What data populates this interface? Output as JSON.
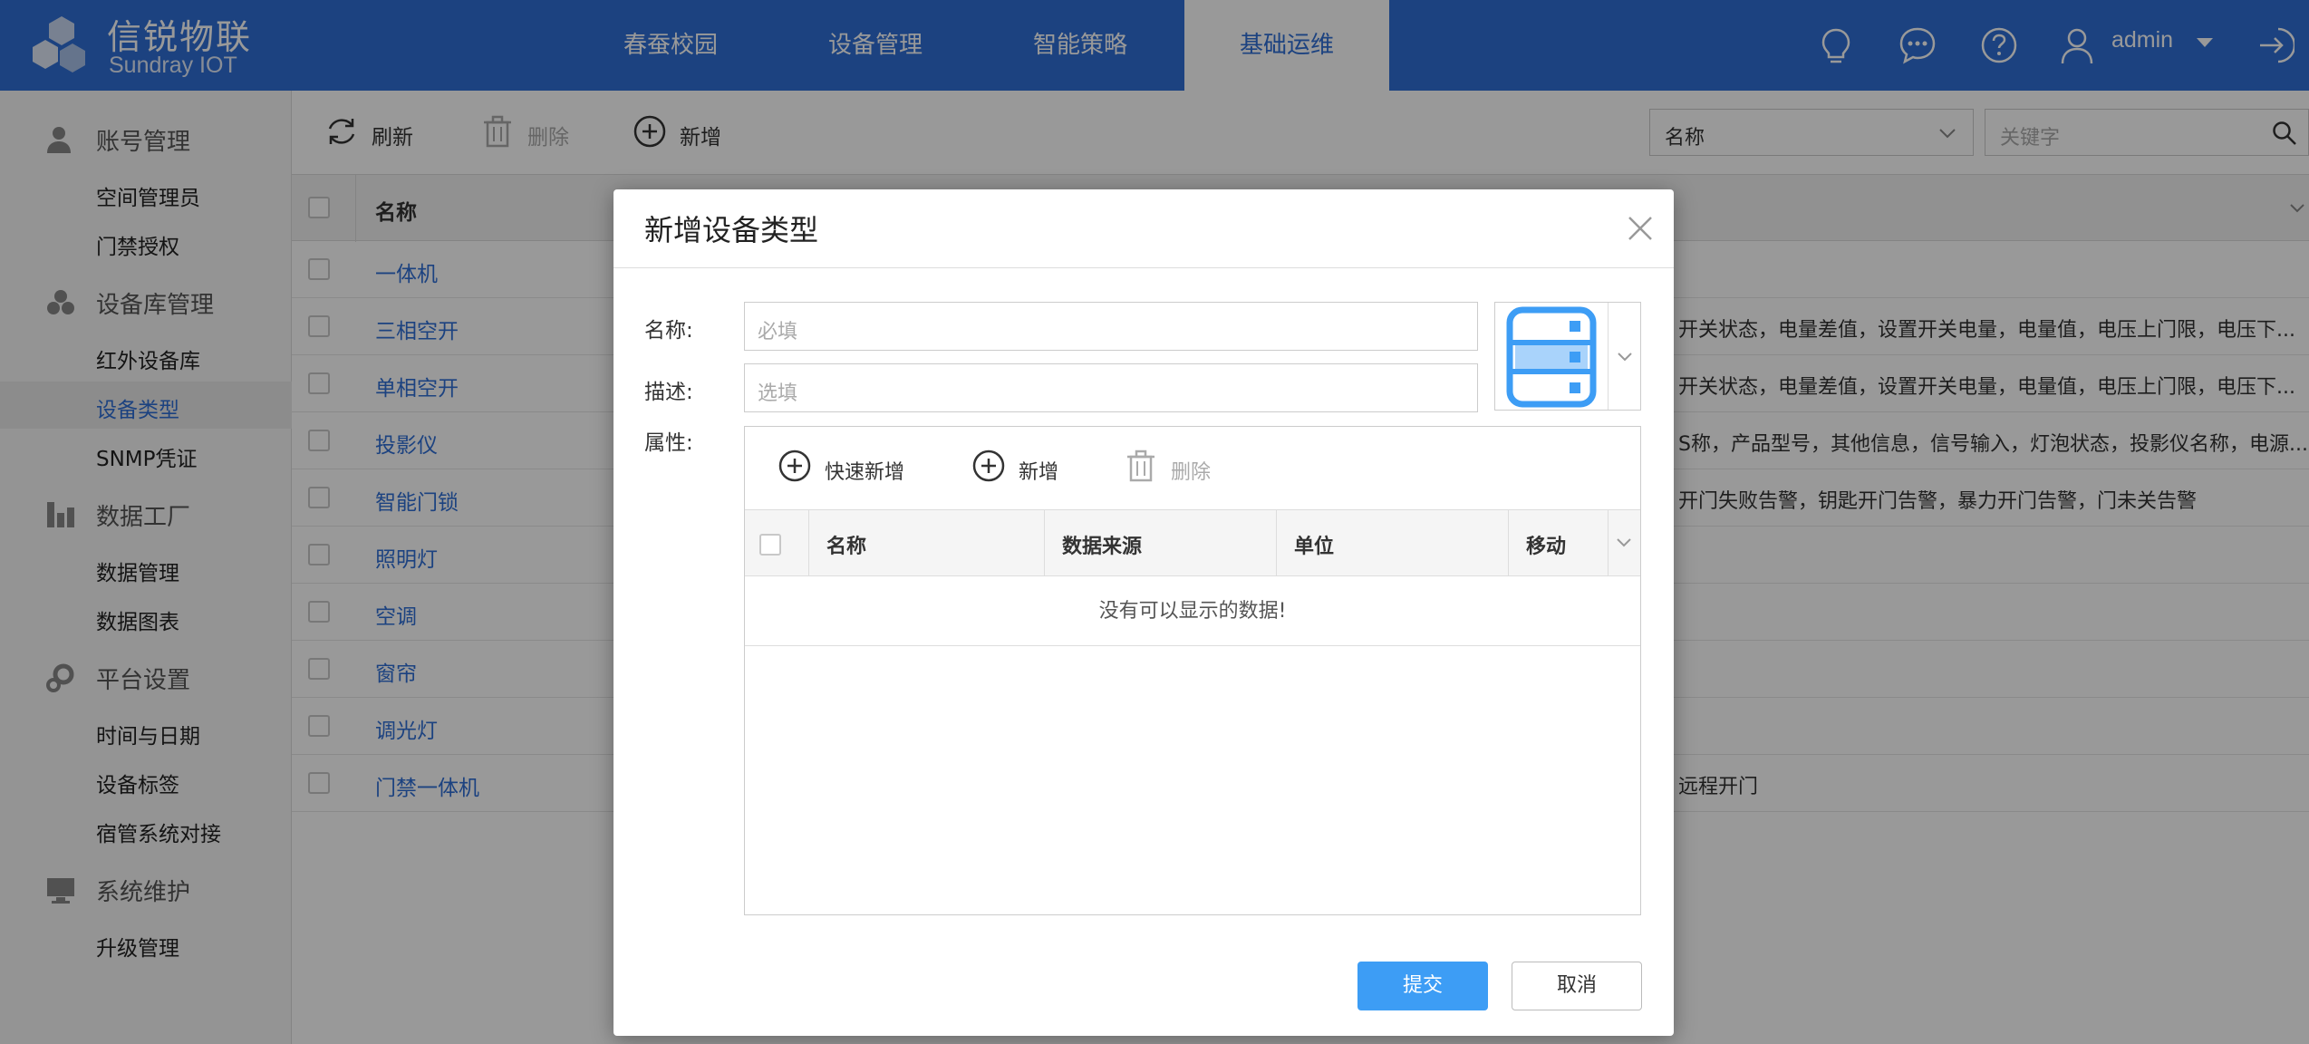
{
  "brand": {
    "name_cn": "信锐物联",
    "name_en": "Sundray IOT"
  },
  "nav": [
    "春蚕校园",
    "设备管理",
    "智能策略",
    "基础运维"
  ],
  "user": {
    "name": "admin"
  },
  "sidebar": {
    "groups": [
      {
        "label": "账号管理",
        "icon": "user-icon",
        "items": [
          "空间管理员",
          "门禁授权"
        ]
      },
      {
        "label": "设备库管理",
        "icon": "device-library-icon",
        "items": [
          "红外设备库",
          "设备类型",
          "SNMP凭证"
        ]
      },
      {
        "label": "数据工厂",
        "icon": "data-factory-icon",
        "items": [
          "数据管理",
          "数据图表"
        ]
      },
      {
        "label": "平台设置",
        "icon": "settings-icon",
        "items": [
          "时间与日期",
          "设备标签",
          "宿管系统对接"
        ]
      },
      {
        "label": "系统维护",
        "icon": "monitor-icon",
        "items": [
          "升级管理"
        ]
      }
    ],
    "active_item": "设备类型"
  },
  "toolbar": {
    "refresh": "刷新",
    "delete": "删除",
    "add": "新增"
  },
  "filter": {
    "field": "名称",
    "keyword_placeholder": "关键字"
  },
  "table": {
    "header_name": "名称",
    "rows": [
      {
        "name": "一体机",
        "props": ""
      },
      {
        "name": "三相空开",
        "props": "开关状态，电量差值，设置开关电量，电量值，电压上门限，电压下..."
      },
      {
        "name": "单相空开",
        "props": "开关状态，电量差值，设置开关电量，电量值，电压上门限，电压下..."
      },
      {
        "name": "投影仪",
        "props": "S称，产品型号，其他信息，信号输入，灯泡状态，投影仪名称，电源..."
      },
      {
        "name": "智能门锁",
        "props": "开门失败告警，钥匙开门告警，暴力开门告警，门未关告警"
      },
      {
        "name": "照明灯",
        "props": ""
      },
      {
        "name": "空调",
        "props": ""
      },
      {
        "name": "窗帘",
        "props": ""
      },
      {
        "name": "调光灯",
        "props": ""
      },
      {
        "name": "门禁一体机",
        "props": "远程开门"
      }
    ]
  },
  "modal": {
    "title": "新增设备类型",
    "name_label": "名称:",
    "name_placeholder": "必填",
    "desc_label": "描述:",
    "desc_placeholder": "选填",
    "attr_label": "属性:",
    "attr_toolbar": {
      "quick_add": "快速新增",
      "add": "新增",
      "delete": "删除"
    },
    "attr_columns": [
      "名称",
      "数据来源",
      "单位",
      "移动"
    ],
    "empty_text": "没有可以显示的数据!",
    "submit": "提交",
    "cancel": "取消"
  },
  "colors": {
    "brand_blue": "#2f6fd6",
    "submit_blue": "#3d9df5",
    "icon_blue": "#3d9df5"
  }
}
